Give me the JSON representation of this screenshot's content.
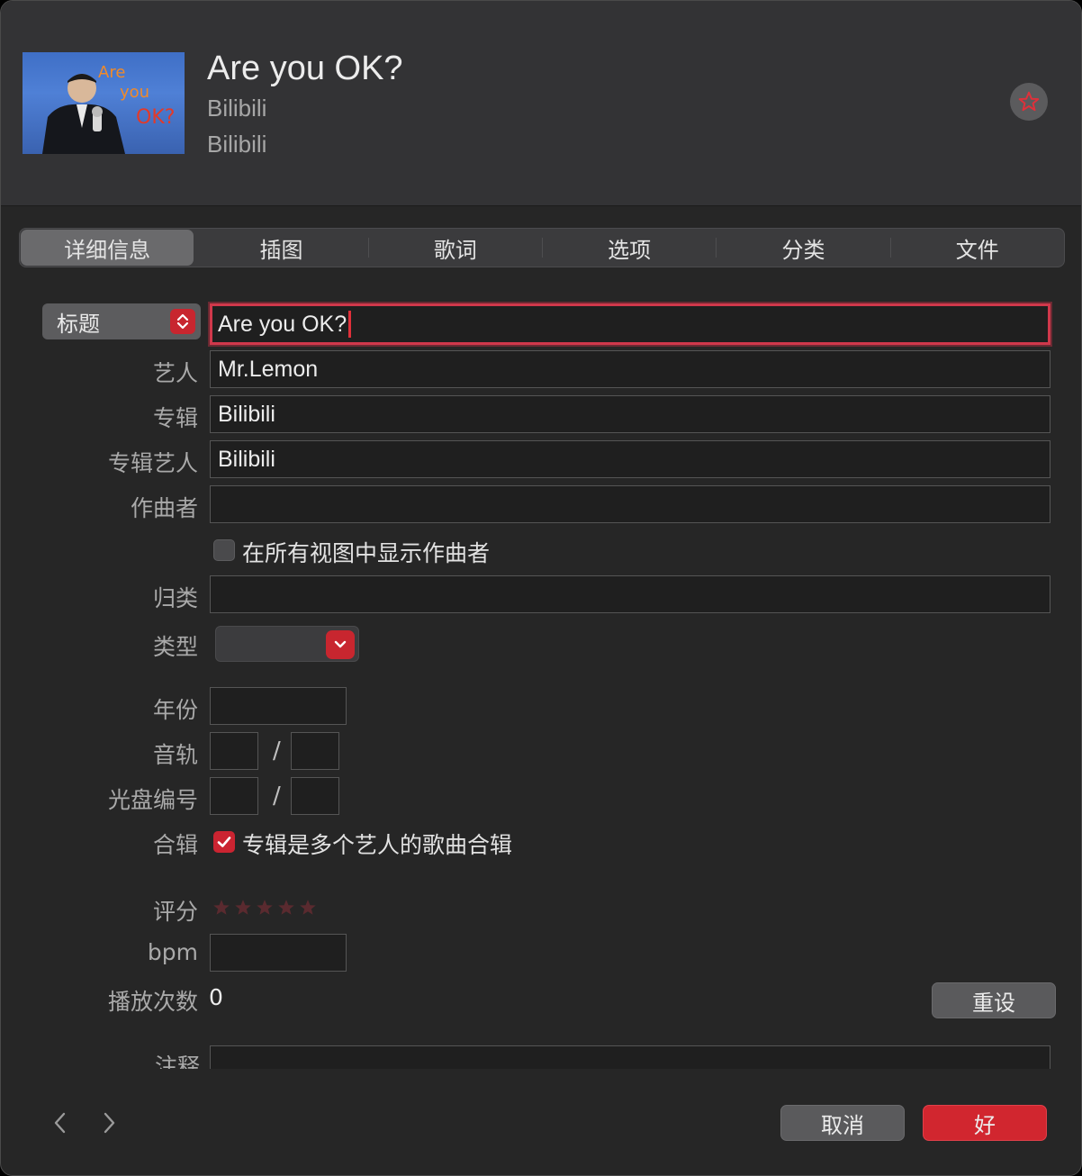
{
  "header": {
    "title": "Are you OK?",
    "artist": "Bilibili",
    "album": "Bilibili",
    "artwork_text": [
      "Are",
      "you",
      "OK?"
    ]
  },
  "tabs": [
    {
      "label": "详细信息",
      "active": true
    },
    {
      "label": "插图",
      "active": false
    },
    {
      "label": "歌词",
      "active": false
    },
    {
      "label": "选项",
      "active": false
    },
    {
      "label": "分类",
      "active": false
    },
    {
      "label": "文件",
      "active": false
    }
  ],
  "form": {
    "field_selector": "标题",
    "title_value": "Are you OK?",
    "labels": {
      "artist": "艺人",
      "album": "专辑",
      "album_artist": "专辑艺人",
      "composer": "作曲者",
      "grouping": "归类",
      "genre": "类型",
      "year": "年份",
      "track": "音轨",
      "disc": "光盘编号",
      "compilation": "合辑",
      "rating": "评分",
      "bpm": "bpm",
      "play_count": "播放次数",
      "comments": "注释"
    },
    "artist_value": "Mr.Lemon",
    "album_value": "Bilibili",
    "album_artist_value": "Bilibili",
    "composer_value": "",
    "show_composer_label": "在所有视图中显示作曲者",
    "show_composer_checked": false,
    "grouping_value": "",
    "genre_value": "",
    "year_value": "",
    "track_value": "",
    "track_total": "",
    "disc_value": "",
    "disc_total": "",
    "slash": "/",
    "compilation_label": "专辑是多个艺人的歌曲合辑",
    "compilation_checked": true,
    "rating": 0,
    "rating_max": 5,
    "bpm_value": "",
    "play_count_value": "0",
    "reset_label": "重设"
  },
  "footer": {
    "cancel_label": "取消",
    "ok_label": "好"
  },
  "colors": {
    "accent": "#d1262f",
    "background": "#262626",
    "header": "#333335"
  }
}
